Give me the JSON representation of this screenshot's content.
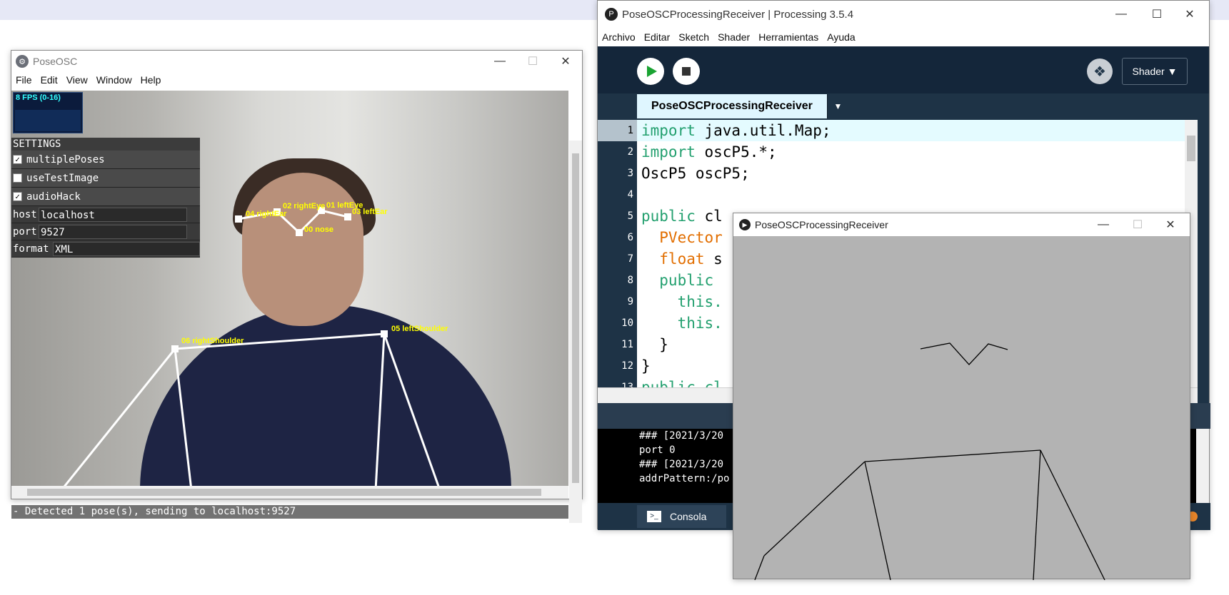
{
  "poseosc": {
    "title": "PoseOSC",
    "menu": [
      "File",
      "Edit",
      "View",
      "Window",
      "Help"
    ],
    "fps": "8 FPS (0-16)",
    "settings": {
      "header": "SETTINGS",
      "toggles": [
        {
          "label": "multiplePoses",
          "checked": true
        },
        {
          "label": "useTestImage",
          "checked": false
        },
        {
          "label": "audioHack",
          "checked": true
        }
      ],
      "fields": [
        {
          "key": "host",
          "value": "localhost"
        },
        {
          "key": "port",
          "value": "9527"
        },
        {
          "key": "format",
          "value": "XML"
        }
      ]
    },
    "keypoints": [
      "00 nose",
      "01 leftEye",
      "02 rightEye",
      "03 leftEar",
      "04 rightEar",
      "05 leftShoulder",
      "06 rightShoulder"
    ],
    "status": "- Detected 1 pose(s), sending to localhost:9527"
  },
  "ide": {
    "title": "PoseOSCProcessingReceiver | Processing 3.5.4",
    "menu": [
      "Archivo",
      "Editar",
      "Sketch",
      "Shader",
      "Herramientas",
      "Ayuda"
    ],
    "mode_button": "Shader ▼",
    "tab": "PoseOSCProcessingReceiver",
    "line_numbers": [
      "1",
      "2",
      "3",
      "4",
      "5",
      "6",
      "7",
      "8",
      "9",
      "10",
      "11",
      "12",
      "13"
    ],
    "console_lines": [
      "### [2021/3/20",
      "port 0",
      "### [2021/3/20",
      "addrPattern:/po"
    ],
    "console_tab": "Consola",
    "colors": {
      "run": "#1aa332",
      "keyword": "#23a06f",
      "type": "#e26e00",
      "background": "#1e3346"
    }
  },
  "output": {
    "title": "PoseOSCProcessingReceiver"
  }
}
